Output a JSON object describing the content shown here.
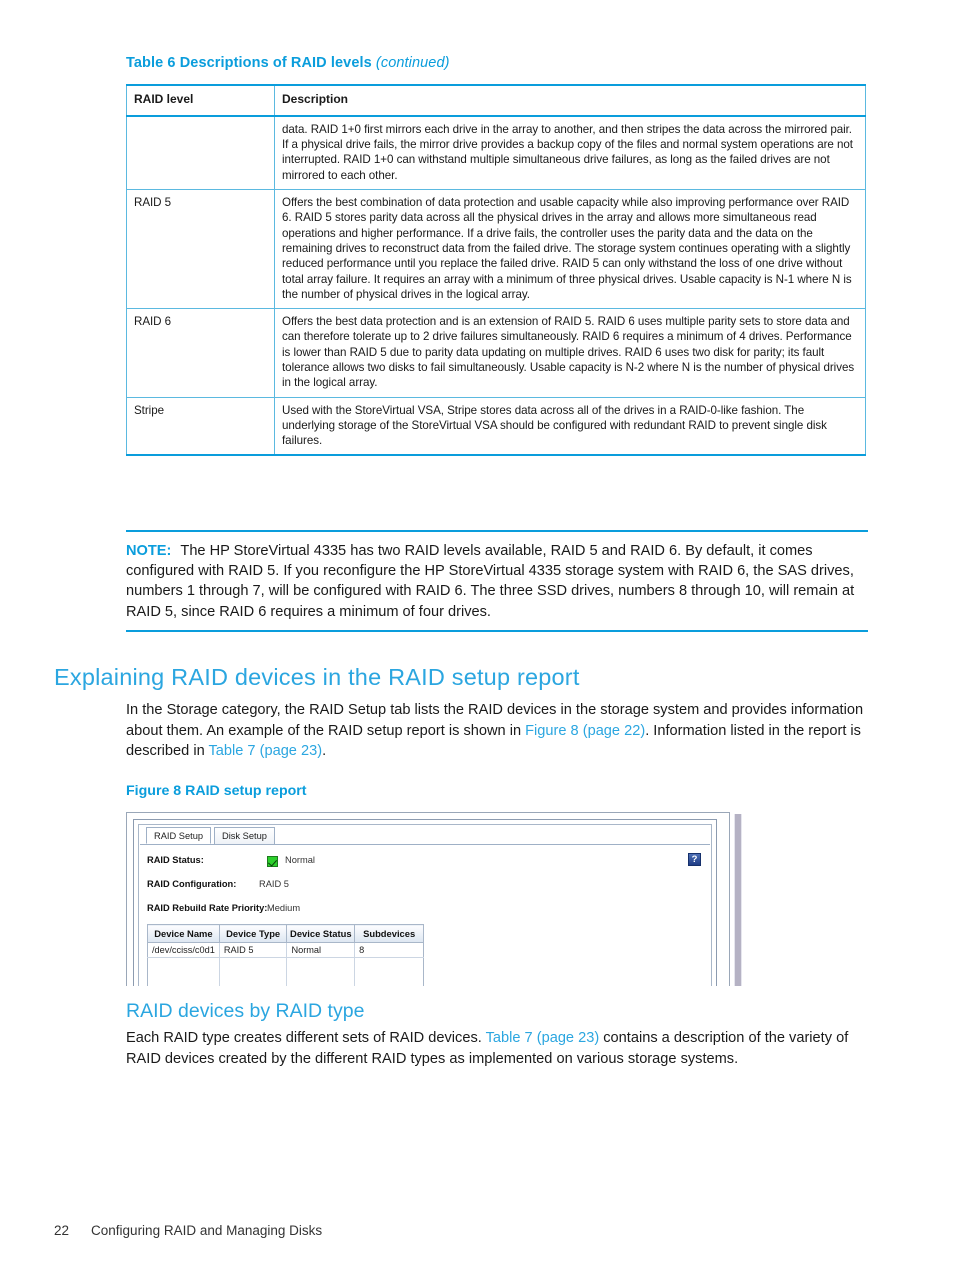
{
  "table6": {
    "caption_main": "Table 6 Descriptions of RAID levels",
    "caption_continued": "(continued)",
    "headers": [
      "RAID level",
      "Description"
    ],
    "rows": [
      {
        "level": "",
        "description": "data. RAID 1+0 first mirrors each drive in the array to another, and then stripes the data across the mirrored pair. If a physical drive fails, the mirror drive provides a backup copy of the files and normal system operations are not interrupted. RAID 1+0 can withstand multiple simultaneous drive failures, as long as the failed drives are not mirrored to each other."
      },
      {
        "level": "RAID 5",
        "description": "Offers the best combination of data protection and usable capacity while also improving performance over RAID 6. RAID 5 stores parity data across all the physical drives in the array and allows more simultaneous read operations and higher performance. If a drive fails, the controller uses the parity data and the data on the remaining drives to reconstruct data from the failed drive. The storage system continues operating with a slightly reduced performance until you replace the failed drive. RAID 5 can only withstand the loss of one drive without total array failure. It requires an array with a minimum of three physical drives. Usable capacity is N-1 where N is the number of physical drives in the logical array."
      },
      {
        "level": "RAID 6",
        "description": "Offers the best data protection and is an extension of RAID 5. RAID 6 uses multiple parity sets to store data and can therefore tolerate up to 2 drive failures simultaneously. RAID 6 requires a minimum of 4 drives. Performance is lower than RAID 5 due to parity data updating on multiple drives. RAID 6 uses two disk for parity; its fault tolerance allows two disks to fail simultaneously. Usable capacity is N-2 where N is the number of physical drives in the logical array."
      },
      {
        "level": "Stripe",
        "description": "Used with the StoreVirtual VSA, Stripe stores data across all of the drives in a RAID-0-like fashion. The underlying storage of the StoreVirtual VSA should be configured with redundant RAID to prevent single disk failures."
      }
    ]
  },
  "note": {
    "label": "NOTE:",
    "text": "The HP StoreVirtual 4335 has two RAID levels available, RAID 5 and RAID 6. By default, it comes configured with RAID 5. If you reconfigure the HP StoreVirtual 4335 storage system with RAID 6, the SAS drives, numbers 1 through 7, will be configured with RAID 6. The three SSD drives, numbers 8 through 10, will remain at RAID 5, since RAID 6 requires a minimum of four drives."
  },
  "section": {
    "heading": "Explaining RAID devices in the RAID setup report",
    "intro_part1": "In the Storage category, the RAID Setup tab lists the RAID devices in the storage system and provides information about them. An example of the RAID setup report is shown in ",
    "intro_xref1": "Figure 8 (page 22)",
    "intro_part2": ". Information listed in the report is described in ",
    "intro_xref2": "Table 7 (page 23)",
    "intro_part3": "."
  },
  "figure8": {
    "caption": "Figure 8 RAID setup report",
    "tabs": [
      {
        "label": "RAID Setup",
        "active": true
      },
      {
        "label": "Disk Setup",
        "active": false
      }
    ],
    "help_icon_glyph": "?",
    "fields": [
      {
        "label": "RAID Status:",
        "value": "Normal",
        "icon": "green-check-icon"
      },
      {
        "label": "RAID Configuration:",
        "value": "RAID 5"
      },
      {
        "label": "RAID Rebuild Rate Priority:",
        "value": "Medium"
      }
    ],
    "device_table": {
      "headers": [
        "Device Name",
        "Device Type",
        "Device Status",
        "Subdevices"
      ],
      "rows": [
        [
          "/dev/cciss/c0d1",
          "RAID 5",
          "Normal",
          "8"
        ]
      ]
    }
  },
  "subsection": {
    "heading": "RAID devices by RAID type",
    "para_part1": "Each RAID type creates different sets of RAID devices. ",
    "para_xref": "Table 7 (page 23)",
    "para_part2": " contains a description of the variety of RAID devices created by the different RAID types as implemented on various storage systems."
  },
  "footer": {
    "page_number": "22",
    "chapter_title": "Configuring RAID and Managing Disks"
  },
  "colors": {
    "accent_blue": "#0a9ddc",
    "heading_blue": "#2ba6e0",
    "status_green": "#2ccf2c"
  }
}
